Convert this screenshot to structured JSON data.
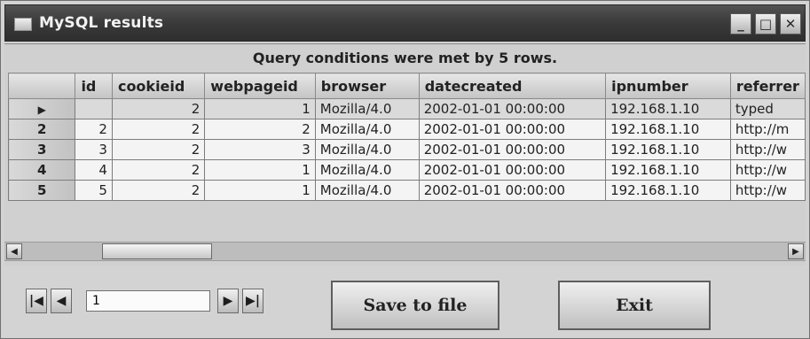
{
  "window": {
    "title": "MySQL results",
    "controls": {
      "minimize": "_",
      "maximize": "□",
      "close": "✕"
    }
  },
  "grid": {
    "caption": "Query conditions were met by 5 rows.",
    "columns": [
      "id",
      "cookieid",
      "webpageid",
      "browser",
      "datecreated",
      "ipnumber",
      "referrer"
    ],
    "rows": [
      {
        "row_label": "",
        "current": true,
        "cells": [
          "",
          "2",
          "1",
          "Mozilla/4.0",
          "2002-01-01 00:00:00",
          "192.168.1.10",
          "typed"
        ]
      },
      {
        "row_label": "2",
        "current": false,
        "cells": [
          "2",
          "2",
          "2",
          "Mozilla/4.0",
          "2002-01-01 00:00:00",
          "192.168.1.10",
          "http://m"
        ]
      },
      {
        "row_label": "3",
        "current": false,
        "cells": [
          "3",
          "2",
          "3",
          "Mozilla/4.0",
          "2002-01-01 00:00:00",
          "192.168.1.10",
          "http://w"
        ]
      },
      {
        "row_label": "4",
        "current": false,
        "cells": [
          "4",
          "2",
          "1",
          "Mozilla/4.0",
          "2002-01-01 00:00:00",
          "192.168.1.10",
          "http://w"
        ]
      },
      {
        "row_label": "5",
        "current": false,
        "cells": [
          "5",
          "2",
          "1",
          "Mozilla/4.0",
          "2002-01-01 00:00:00",
          "192.168.1.10",
          "http://w"
        ]
      }
    ]
  },
  "navigator": {
    "first": "|◀",
    "prev": "◀",
    "next": "▶",
    "last": "▶|",
    "record_value": "1"
  },
  "buttons": {
    "save": "Save to file",
    "exit": "Exit"
  }
}
